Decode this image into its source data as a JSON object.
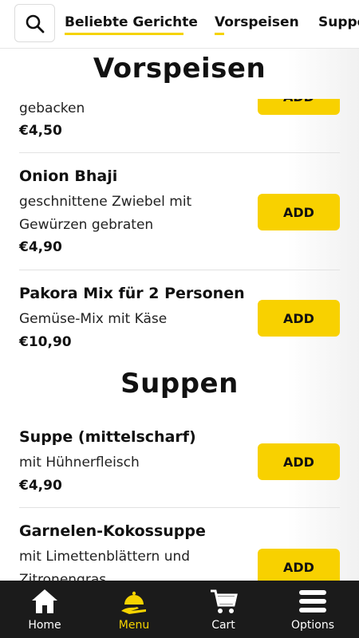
{
  "header": {
    "tabs": [
      {
        "label": "Beliebte Gerichte"
      },
      {
        "label": "Vorspeisen"
      },
      {
        "label": "Suppen"
      }
    ]
  },
  "sections": [
    {
      "title": "Vorspeisen",
      "items": [
        {
          "name": "",
          "description": "gebacken",
          "price": "€4,50",
          "add_label": "ADD"
        },
        {
          "name": "Onion Bhaji",
          "description": "geschnittene Zwiebel mit Gewürzen gebraten",
          "price": "€4,90",
          "add_label": "ADD"
        },
        {
          "name": "Pakora Mix für 2 Personen",
          "description": "Gemüse-Mix mit Käse",
          "price": "€10,90",
          "add_label": "ADD"
        }
      ]
    },
    {
      "title": "Suppen",
      "items": [
        {
          "name": "Suppe (mittelscharf)",
          "description": "mit Hühnerfleisch",
          "price": "€4,90",
          "add_label": "ADD"
        },
        {
          "name": "Garnelen-Kokossuppe",
          "description": "mit Limettenblättern und Zitronengras",
          "price": "",
          "add_label": "ADD"
        }
      ]
    }
  ],
  "bottom_nav": [
    {
      "label": "Home",
      "icon": "home-icon"
    },
    {
      "label": "Menu",
      "icon": "menu-icon"
    },
    {
      "label": "Cart",
      "icon": "cart-icon"
    },
    {
      "label": "Options",
      "icon": "options-icon"
    }
  ],
  "colors": {
    "accent": "#f8d100",
    "nav_background": "#1b1b1b",
    "nav_active": "#f5d300"
  }
}
